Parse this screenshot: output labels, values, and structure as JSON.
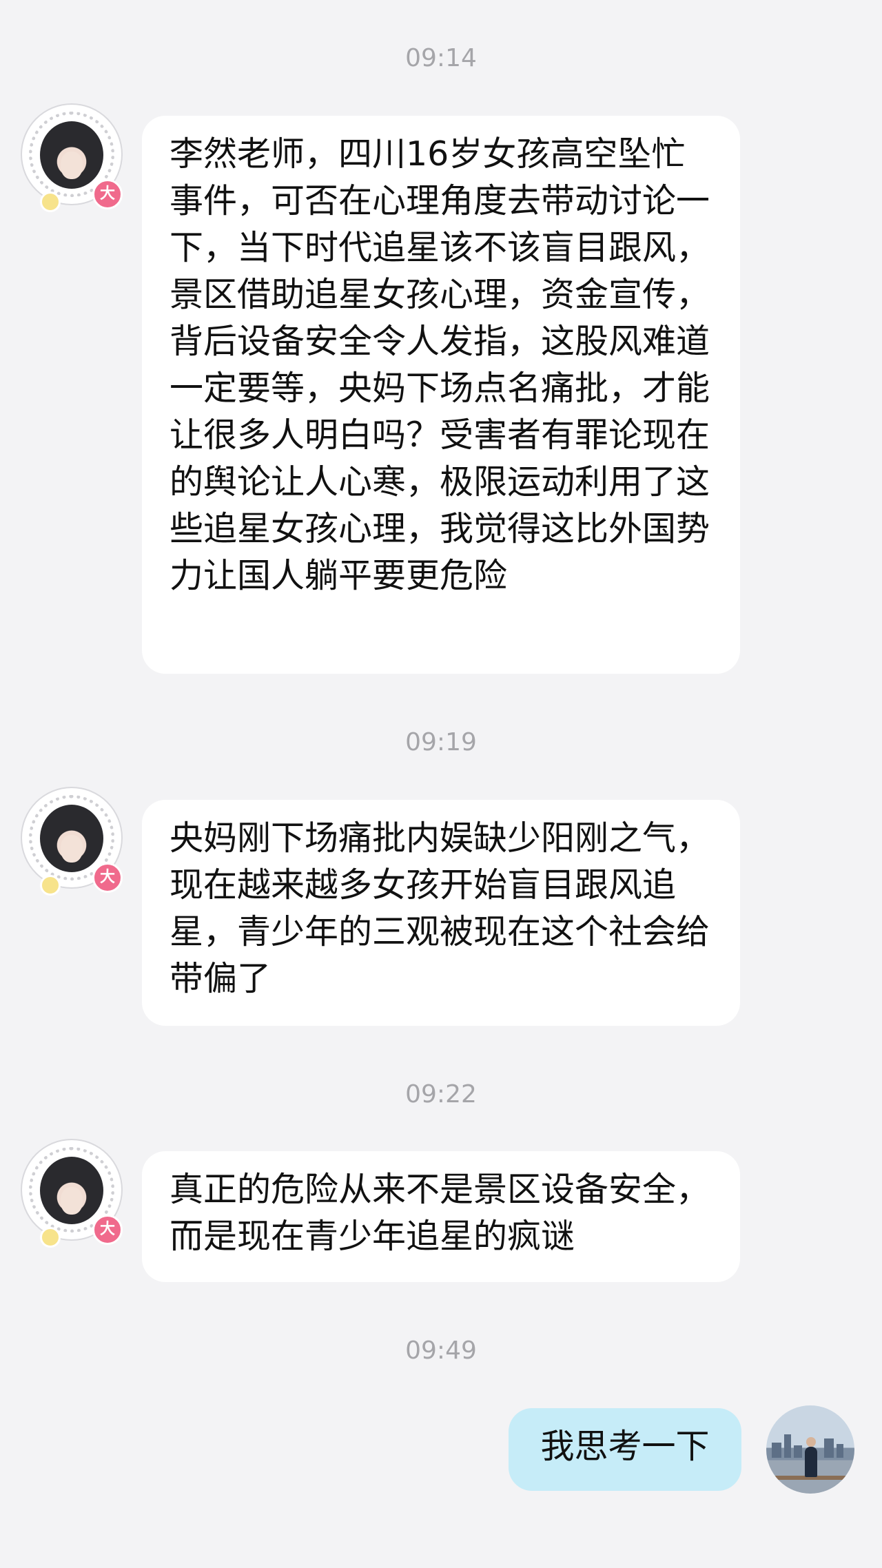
{
  "messages": [
    {
      "time": "09:14",
      "sender": "other",
      "badge": "大",
      "text": "李然老师，四川16岁女孩高空坠忙事件，可否在心理角度去带动讨论一下，当下时代追星该不该盲目跟风，景区借助追星女孩心理，资金宣传，背后设备安全令人发指，这股风难道一定要等，央妈下场点名痛批，才能让很多人明白吗？受害者有罪论现在的舆论让人心寒，极限运动利用了这些追星女孩心理，我觉得这比外国势力让国人躺平要更危险"
    },
    {
      "time": "09:19",
      "sender": "other",
      "badge": "大",
      "text": "央妈刚下场痛批内娱缺少阳刚之气，现在越来越多女孩开始盲目跟风追星，青少年的三观被现在这个社会给带偏了"
    },
    {
      "time": "09:22",
      "sender": "other",
      "badge": "大",
      "text": "真正的危险从来不是景区设备安全，而是现在青少年追星的疯谜"
    },
    {
      "time": "09:49",
      "sender": "me",
      "text": "我思考一下"
    }
  ]
}
